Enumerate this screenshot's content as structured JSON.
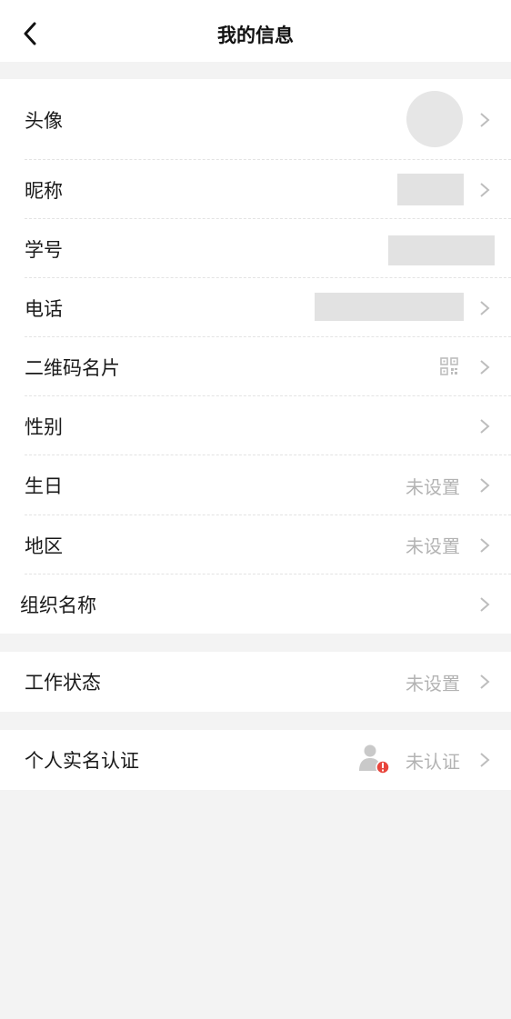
{
  "header": {
    "title": "我的信息",
    "back_icon": "back-arrow-icon"
  },
  "rows": {
    "avatar": {
      "label": "头像"
    },
    "nickname": {
      "label": "昵称"
    },
    "student_id": {
      "label": "学号"
    },
    "phone": {
      "label": "电话"
    },
    "qr_card": {
      "label": "二维码名片",
      "icon": "qr-code-icon"
    },
    "gender": {
      "label": "性别"
    },
    "birthday": {
      "label": "生日",
      "value": "未设置"
    },
    "region": {
      "label": "地区",
      "value": "未设置"
    },
    "organization": {
      "label": "组织名称"
    },
    "work_status": {
      "label": "工作状态",
      "value": "未设置"
    },
    "real_name": {
      "label": "个人实名认证",
      "value": "未认证",
      "icon": "user-alert-icon"
    }
  },
  "colors": {
    "background": "#f3f3f3",
    "card": "#ffffff",
    "muted_text": "#b3b3b3",
    "alert": "#e8453c"
  }
}
